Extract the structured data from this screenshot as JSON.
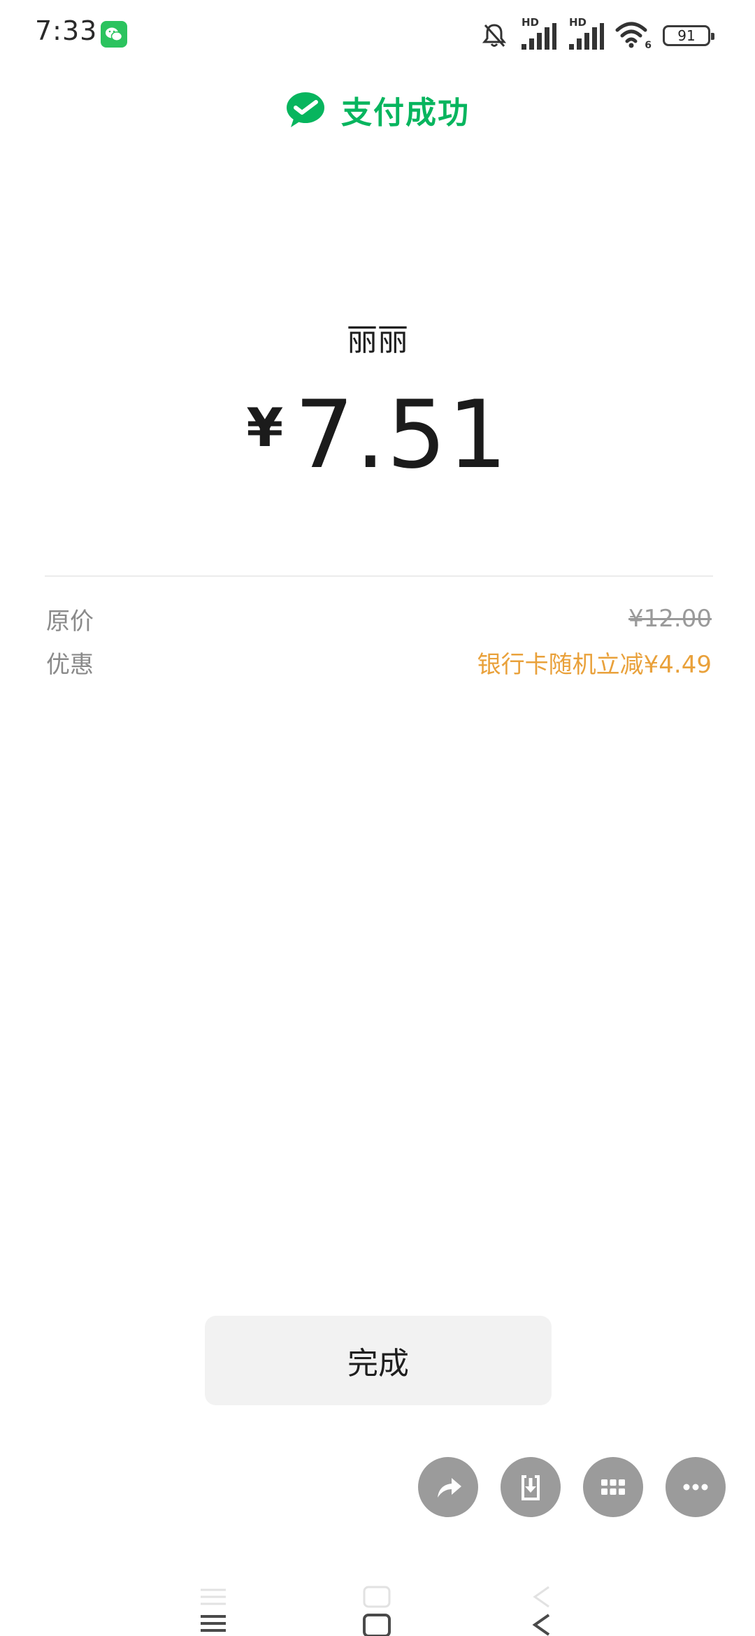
{
  "status_bar": {
    "time": "7:33",
    "network_1": "HD",
    "network_2": "HD",
    "wifi_sub": "6",
    "battery": "91"
  },
  "header": {
    "title": "支付成功",
    "icon": "wechat-pay-icon",
    "color": "#07b55e"
  },
  "payment": {
    "payee": "丽丽",
    "currency_symbol": "¥",
    "amount": "7.51"
  },
  "details": {
    "original_label": "原价",
    "original_value": "¥12.00",
    "discount_label": "优惠",
    "discount_value": "银行卡随机立减¥4.49",
    "discount_color": "#e9a13b"
  },
  "done_label": "完成",
  "actions": {
    "icons": [
      "share-icon",
      "download-icon",
      "grid-icon",
      "more-icon"
    ]
  },
  "nav_bar": {
    "icons": [
      "menu-icon",
      "home-icon",
      "back-icon"
    ]
  }
}
